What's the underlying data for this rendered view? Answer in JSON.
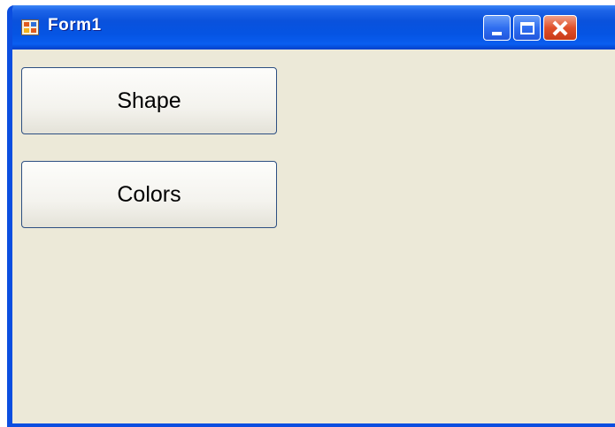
{
  "window": {
    "title": "Form1",
    "icon": "form-icon",
    "controls": [
      "minimize-icon",
      "maximize-icon",
      "close-icon"
    ]
  },
  "buttons": {
    "shape_label": "Shape",
    "colors_label": "Colors"
  },
  "colors": {
    "titlebar": "#0554e3",
    "client_background": "#ece9d8",
    "close_button": "#e0502a"
  }
}
